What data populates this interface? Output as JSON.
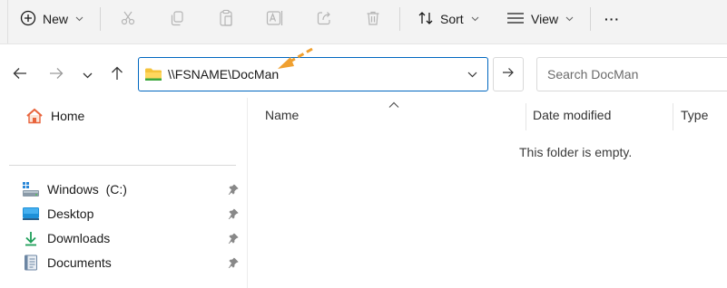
{
  "toolbar": {
    "new_label": "New",
    "sort_label": "Sort",
    "view_label": "View",
    "more_label": "···"
  },
  "address_bar": {
    "path": "\\\\FSNAME\\DocMan"
  },
  "search": {
    "placeholder": "Search DocMan"
  },
  "sidebar": {
    "home": "Home",
    "items": [
      {
        "label": "Windows  (C:)",
        "icon": "drive-icon"
      },
      {
        "label": "Desktop",
        "icon": "desktop-icon"
      },
      {
        "label": "Downloads",
        "icon": "download-icon"
      },
      {
        "label": "Documents",
        "icon": "documents-icon"
      }
    ]
  },
  "content": {
    "columns": [
      "Name",
      "Date modified",
      "Type"
    ],
    "empty_message": "This folder is empty."
  },
  "colors": {
    "accent": "#0067c0",
    "folder_yellow": "#f5c33b",
    "annotation_arrow": "#f0a030"
  }
}
